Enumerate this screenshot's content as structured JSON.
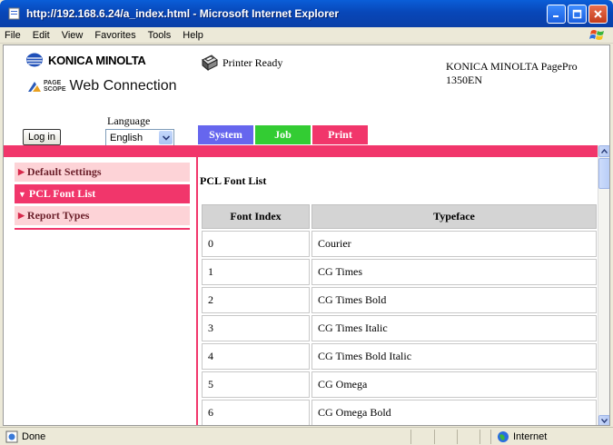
{
  "window": {
    "title": "http://192.168.6.24/a_index.html - Microsoft Internet Explorer"
  },
  "menu": [
    "File",
    "Edit",
    "View",
    "Favorites",
    "Tools",
    "Help"
  ],
  "header": {
    "brand": "KONICA MINOLTA",
    "pagescope_line1": "PAGE",
    "pagescope_line2": "SCOPE",
    "web_connection": "Web Connection",
    "printer_status": "Printer Ready",
    "model_line1": "KONICA MINOLTA PagePro",
    "model_line2": "1350EN",
    "login_label": "Log in",
    "language_label": "Language",
    "language_value": "English"
  },
  "tabs": [
    {
      "label": "System",
      "color": "#6666ee"
    },
    {
      "label": "Job",
      "color": "#33cc33"
    },
    {
      "label": "Print",
      "color": "#f1366b"
    }
  ],
  "sidebar": {
    "items": [
      {
        "label": "Default Settings",
        "active": false
      },
      {
        "label": "PCL Font List",
        "active": true
      },
      {
        "label": "Report Types",
        "active": false
      }
    ]
  },
  "content": {
    "title": "PCL Font List",
    "columns": [
      "Font Index",
      "Typeface"
    ],
    "rows": [
      [
        "0",
        "Courier"
      ],
      [
        "1",
        "CG Times"
      ],
      [
        "2",
        "CG Times Bold"
      ],
      [
        "3",
        "CG Times Italic"
      ],
      [
        "4",
        "CG Times Bold Italic"
      ],
      [
        "5",
        "CG Omega"
      ],
      [
        "6",
        "CG Omega Bold"
      ]
    ]
  },
  "status": {
    "left": "Done",
    "zone": "Internet"
  },
  "colors": {
    "accent": "#f1366b",
    "sidebar_bg": "#fdd3d7"
  }
}
